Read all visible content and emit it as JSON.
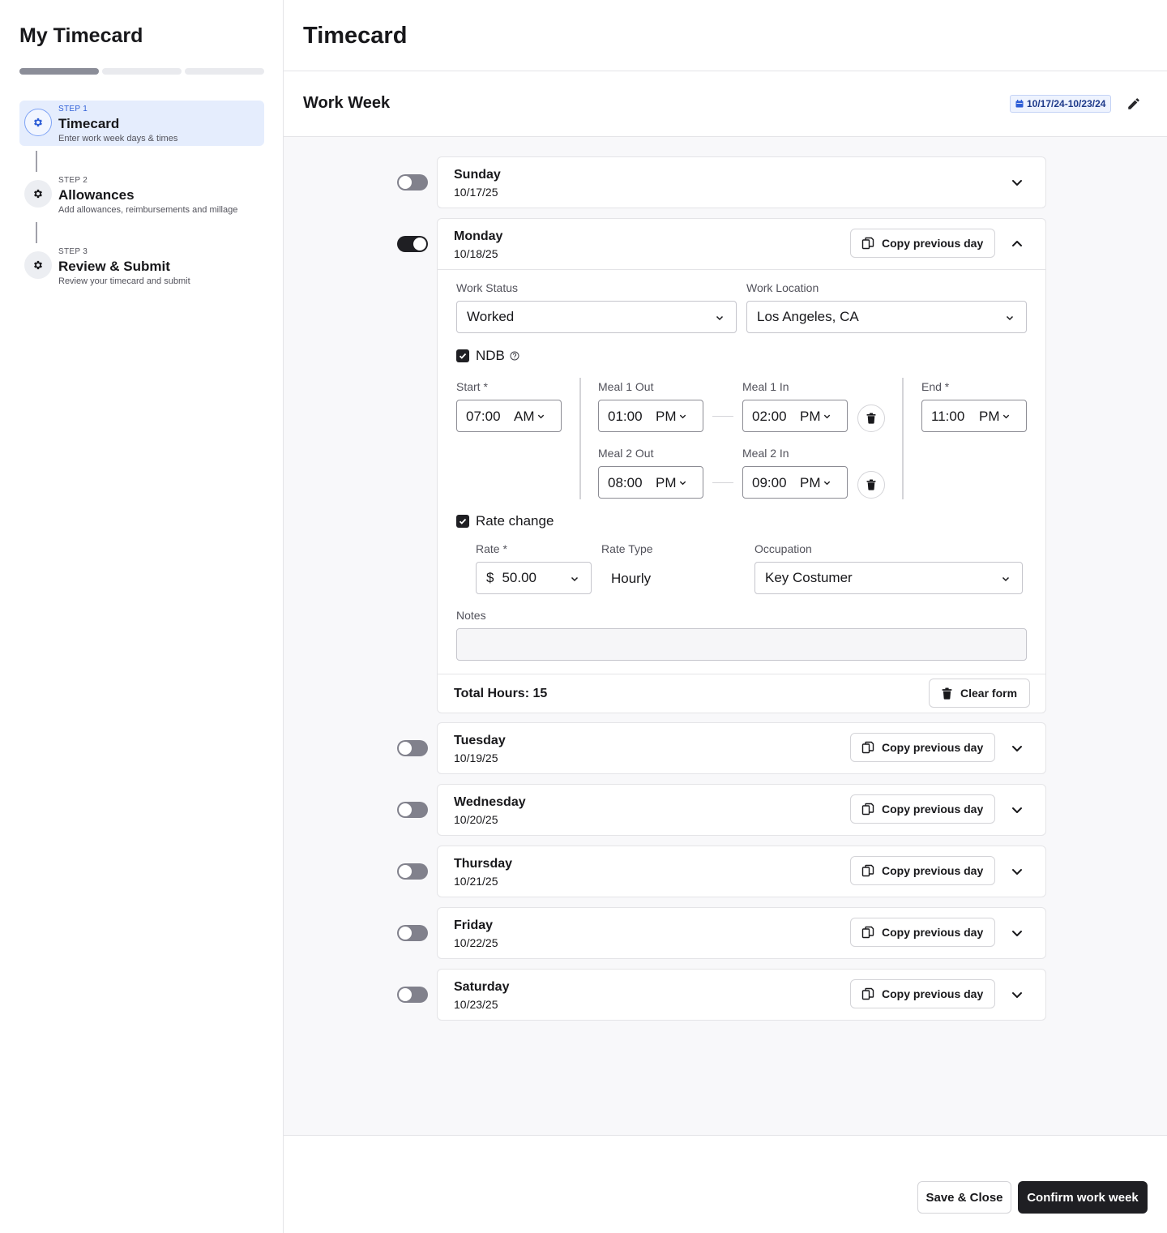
{
  "sidebar": {
    "title": "My Timecard",
    "progress_steps_completed": 1,
    "progress_steps_total": 3,
    "steps": [
      {
        "num": "STEP 1",
        "title": "Timecard",
        "desc": "Enter work week days & times",
        "icon": "gear-icon",
        "active": true
      },
      {
        "num": "STEP 2",
        "title": "Allowances",
        "desc": "Add allowances, reimbursements and millage",
        "icon": "gear-icon",
        "active": false
      },
      {
        "num": "STEP 3",
        "title": "Review & Submit",
        "desc": "Review your timecard and submit",
        "icon": "gear-icon",
        "active": false
      }
    ]
  },
  "header": {
    "title": "Timecard"
  },
  "work_week": {
    "title": "Work Week",
    "date_range": "10/17/24-10/23/24",
    "calendar_icon": "calendar-icon",
    "edit_icon": "pencil-icon"
  },
  "days": [
    {
      "name": "Sunday",
      "date": "10/17/25",
      "enabled": false,
      "expanded": false,
      "copy_label": ""
    },
    {
      "name": "Monday",
      "date": "10/18/25",
      "enabled": true,
      "expanded": true,
      "copy_label": "Copy previous day"
    },
    {
      "name": "Tuesday",
      "date": "10/19/25",
      "enabled": false,
      "expanded": false,
      "copy_label": "Copy previous day"
    },
    {
      "name": "Wednesday",
      "date": "10/20/25",
      "enabled": false,
      "expanded": false,
      "copy_label": "Copy previous day"
    },
    {
      "name": "Thursday",
      "date": "10/21/25",
      "enabled": false,
      "expanded": false,
      "copy_label": "Copy previous day"
    },
    {
      "name": "Friday",
      "date": "10/22/25",
      "enabled": false,
      "expanded": false,
      "copy_label": "Copy previous day"
    },
    {
      "name": "Saturday",
      "date": "10/23/25",
      "enabled": false,
      "expanded": false,
      "copy_label": "Copy previous day"
    }
  ],
  "form": {
    "work_status_label": "Work Status",
    "work_status_value": "Worked",
    "work_location_label": "Work Location",
    "work_location_value": "Los Angeles, CA",
    "ndb_label": "NDB",
    "ndb_checked": true,
    "start_label": "Start *",
    "start": {
      "time": "07:00",
      "ampm": "AM"
    },
    "meal1_out_label": "Meal 1 Out",
    "meal1_out": {
      "time": "01:00",
      "ampm": "PM"
    },
    "meal1_in_label": "Meal 1 In",
    "meal1_in": {
      "time": "02:00",
      "ampm": "PM"
    },
    "meal2_out_label": "Meal 2 Out",
    "meal2_out": {
      "time": "08:00",
      "ampm": "PM"
    },
    "meal2_in_label": "Meal 2 In",
    "meal2_in": {
      "time": "09:00",
      "ampm": "PM"
    },
    "end_label": "End *",
    "end": {
      "time": "11:00",
      "ampm": "PM"
    },
    "rate_change_label": "Rate change",
    "rate_change_checked": true,
    "rate_label": "Rate *",
    "rate_currency": "$",
    "rate_value": "50.00",
    "rate_type_label": "Rate Type",
    "rate_type_value": "Hourly",
    "occupation_label": "Occupation",
    "occupation_value": "Key Costumer",
    "notes_label": "Notes",
    "notes_value": "",
    "total_hours": "Total Hours: 15",
    "clear_label": "Clear form"
  },
  "footer": {
    "save_label": "Save & Close",
    "confirm_label": "Confirm work week"
  },
  "colors": {
    "accent": "#2f5fd7",
    "active_step_bg": "#e5edfd",
    "primary_button": "#1f1f23",
    "toggle_off": "#81818c"
  }
}
